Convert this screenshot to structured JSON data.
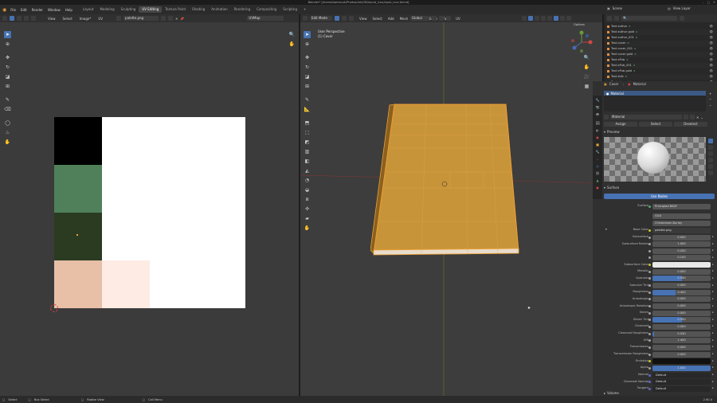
{
  "window": {
    "title": "Blender* [/home/bpmsouk/Photos/drbl/3D/epub_icon/epub_icon.blend]"
  },
  "topbar": {
    "menus": [
      "File",
      "Edit",
      "Render",
      "Window",
      "Help"
    ],
    "workspaces": [
      "Layout",
      "Modeling",
      "Sculpting",
      "UV Editing",
      "Texture Paint",
      "Shading",
      "Animation",
      "Rendering",
      "Compositing",
      "Scripting"
    ],
    "active_workspace": "UV Editing",
    "scene_label": "Scene",
    "view_layer_label": "View Layer"
  },
  "uv_editor": {
    "header": {
      "menus": [
        "View",
        "Select",
        "Image*",
        "UV"
      ],
      "image_name": "palette.png",
      "uvmap": "UVMap"
    },
    "palette": {
      "swatches": [
        {
          "name": "black",
          "color": "#000000"
        },
        {
          "name": "green",
          "color": "#4f8059"
        },
        {
          "name": "dark-green",
          "color": "#2a3b22"
        },
        {
          "name": "peach",
          "color": "#e8bfa7"
        },
        {
          "name": "light-peach",
          "color": "#fdebe4"
        }
      ]
    }
  },
  "viewport": {
    "header": {
      "mode": "Edit Mode",
      "menus": [
        "View",
        "Select",
        "Add",
        "Mesh",
        "Vertex",
        "Edge",
        "Face",
        "UV"
      ],
      "orientation": "Global",
      "options_label": "Options"
    },
    "overlay": {
      "view_name": "User Perspective",
      "object_name": "(1) Cover"
    }
  },
  "outliner": {
    "items": [
      {
        "label": "Text author"
      },
      {
        "label": "Text author gold"
      },
      {
        "label": "Text author_001"
      },
      {
        "label": "Text cover"
      },
      {
        "label": "Text cover_001"
      },
      {
        "label": "Text cover gold"
      },
      {
        "label": "Text ePub"
      },
      {
        "label": "Text ePub_001"
      },
      {
        "label": "Text ePub gold"
      },
      {
        "label": "Text side"
      },
      {
        "label": "Text side gold"
      }
    ]
  },
  "properties": {
    "object_name": "Cover",
    "material_tab": "Material",
    "slot_name": "Material",
    "assign": "Assign",
    "select": "Select",
    "deselect": "Deselect",
    "material_name": "Material",
    "preview_label": "Preview",
    "surface_section": "Surface",
    "use_nodes": "Use Nodes",
    "surface_label": "Surface",
    "surface_value": "Principled BSDF",
    "distribution": "GGX",
    "subsurface_method": "Christensen-Burley",
    "base_color_label": "Base Color",
    "base_color_value": "palette.png",
    "rows": [
      {
        "label": "Subsurface",
        "value": "0.000",
        "fill": 0
      },
      {
        "label": "Subsurface Radius",
        "value": "1.000",
        "fill": 0
      },
      {
        "label": "",
        "value": "0.200",
        "fill": 0
      },
      {
        "label": "",
        "value": "0.100",
        "fill": 0
      },
      {
        "label": "Subsurface Color",
        "value": "",
        "fill": 0,
        "color": "#e8e8e8"
      },
      {
        "label": "Metallic",
        "value": "0.000",
        "fill": 0
      },
      {
        "label": "Specular",
        "value": "0.500",
        "fill": 0.5
      },
      {
        "label": "Specular Tint",
        "value": "0.000",
        "fill": 0
      },
      {
        "label": "Roughness",
        "value": "0.400",
        "fill": 0.4
      },
      {
        "label": "Anisotropic",
        "value": "0.000",
        "fill": 0
      },
      {
        "label": "Anisotropic Rotation",
        "value": "0.000",
        "fill": 0
      },
      {
        "label": "Sheen",
        "value": "0.000",
        "fill": 0
      },
      {
        "label": "Sheen Tint",
        "value": "0.500",
        "fill": 0.5
      },
      {
        "label": "Clearcoat",
        "value": "0.000",
        "fill": 0
      },
      {
        "label": "Clearcoat Roughness",
        "value": "0.030",
        "fill": 0.03
      },
      {
        "label": "IOR",
        "value": "1.450",
        "fill": 0
      },
      {
        "label": "Transmission",
        "value": "0.000",
        "fill": 0
      },
      {
        "label": "Transmission Roughness",
        "value": "0.000",
        "fill": 0
      },
      {
        "label": "Emission",
        "value": "",
        "fill": 0,
        "color": "#111111"
      },
      {
        "label": "Alpha",
        "value": "1.000",
        "fill": 1
      },
      {
        "label": "Normal",
        "value": "Default",
        "fill": 0,
        "plain": true
      },
      {
        "label": "Clearcoat Normal",
        "value": "Default",
        "fill": 0,
        "plain": true
      },
      {
        "label": "Tangent",
        "value": "Default",
        "fill": 0,
        "plain": true
      }
    ],
    "volume_section": "Volume"
  },
  "statusbar": {
    "select": "Select",
    "box_select": "Box Select",
    "rotate_view": "Rotate View",
    "call_menu": "Call Menu",
    "version": "2.90.0"
  },
  "colors": {
    "accent": "#4772b3",
    "selection_orange": "#e8a23a"
  }
}
